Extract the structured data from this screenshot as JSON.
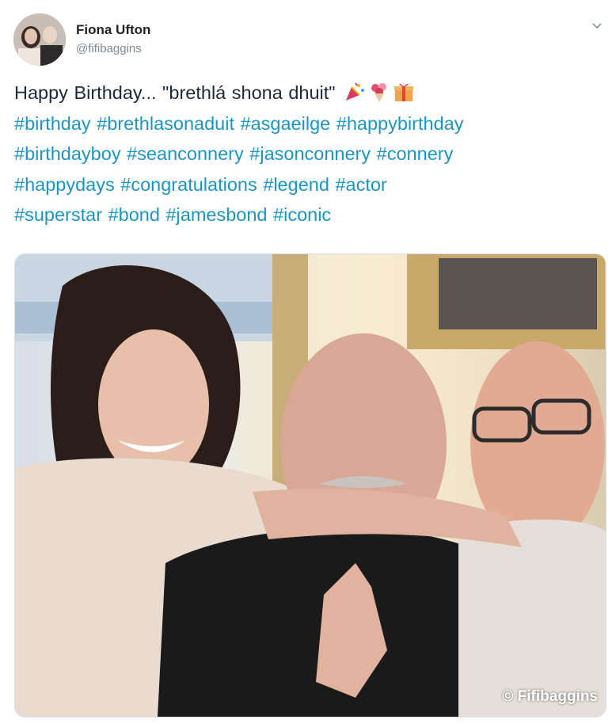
{
  "author": {
    "name": "Fiona Ufton",
    "handle": "@fifibaggins"
  },
  "tweet": {
    "intro_text": "Happy Birthday... \"brethlá shona dhuit\"",
    "emoji_icons": [
      "party-popper-icon",
      "bouquet-icon",
      "gift-icon"
    ],
    "hashtags": [
      "#birthday",
      "#brethlasonaduit",
      "#asgaeilge",
      "#happybirthday",
      "#birthdayboy",
      "#seanconnery",
      "#jasonconnery",
      "#connery",
      "#happydays",
      "#congratulations",
      "#legend",
      "#actor",
      "#superstar",
      "#bond",
      "#jamesbond",
      "#iconic"
    ]
  },
  "media": {
    "watermark": "© Fifibaggins"
  },
  "colors": {
    "hashtag": "#1b95c5",
    "text": "#1c2938",
    "handle": "#7b8a96"
  }
}
